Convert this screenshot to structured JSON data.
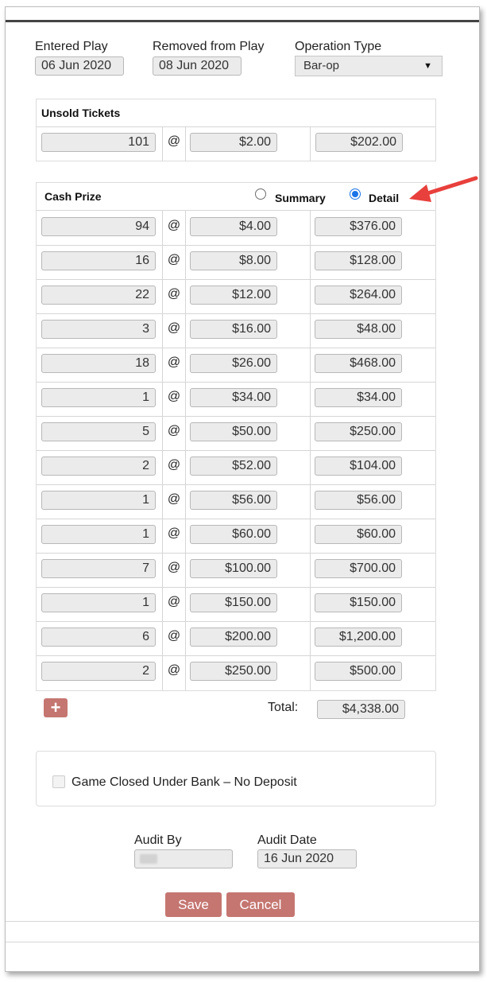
{
  "header": {
    "entered_label": "Entered Play",
    "entered_value": "06 Jun 2020",
    "removed_label": "Removed from Play",
    "removed_value": "08 Jun 2020",
    "optype_label": "Operation Type",
    "optype_value": "Bar-op"
  },
  "unsold": {
    "title": "Unsold Tickets",
    "qty": "101",
    "price": "$2.00",
    "total": "$202.00",
    "at": "@"
  },
  "cash_prize": {
    "title": "Cash Prize",
    "mode_summary_label": "Summary",
    "mode_detail_label": "Detail",
    "selected_mode": "Detail",
    "at": "@",
    "rows": [
      {
        "qty": "94",
        "price": "$4.00",
        "total": "$376.00"
      },
      {
        "qty": "16",
        "price": "$8.00",
        "total": "$128.00"
      },
      {
        "qty": "22",
        "price": "$12.00",
        "total": "$264.00"
      },
      {
        "qty": "3",
        "price": "$16.00",
        "total": "$48.00"
      },
      {
        "qty": "18",
        "price": "$26.00",
        "total": "$468.00"
      },
      {
        "qty": "1",
        "price": "$34.00",
        "total": "$34.00"
      },
      {
        "qty": "5",
        "price": "$50.00",
        "total": "$250.00"
      },
      {
        "qty": "2",
        "price": "$52.00",
        "total": "$104.00"
      },
      {
        "qty": "1",
        "price": "$56.00",
        "total": "$56.00"
      },
      {
        "qty": "1",
        "price": "$60.00",
        "total": "$60.00"
      },
      {
        "qty": "7",
        "price": "$100.00",
        "total": "$700.00"
      },
      {
        "qty": "1",
        "price": "$150.00",
        "total": "$150.00"
      },
      {
        "qty": "6",
        "price": "$200.00",
        "total": "$1,200.00"
      },
      {
        "qty": "2",
        "price": "$250.00",
        "total": "$500.00"
      }
    ],
    "add_icon": "plus-icon",
    "total_label": "Total:",
    "total_value": "$4,338.00"
  },
  "closed": {
    "label": "Game Closed Under Bank – No Deposit",
    "checked": false
  },
  "audit": {
    "by_label": "Audit By",
    "by_value": "",
    "date_label": "Audit Date",
    "date_value": "16 Jun 2020"
  },
  "actions": {
    "save": "Save",
    "cancel": "Cancel"
  },
  "colors": {
    "button": "#c57671",
    "arrow": "#e8403c",
    "radio": "#1a73e8"
  }
}
